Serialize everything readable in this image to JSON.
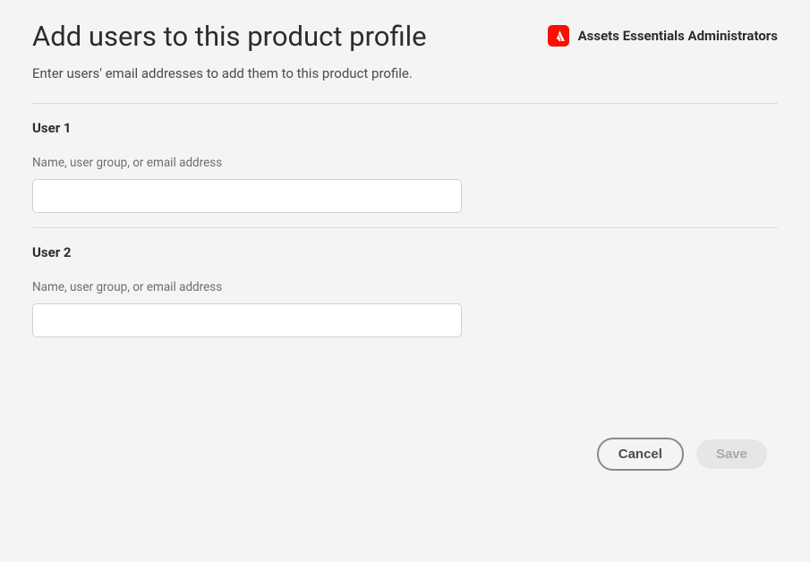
{
  "header": {
    "title": "Add users to this product profile",
    "subtitle": "Enter users' email addresses to add them to this product profile.",
    "product_name": "Assets Essentials Administrators"
  },
  "users": [
    {
      "section_label": "User 1",
      "field_label": "Name, user group, or email address",
      "value": ""
    },
    {
      "section_label": "User 2",
      "field_label": "Name, user group, or email address",
      "value": ""
    }
  ],
  "actions": {
    "cancel_label": "Cancel",
    "save_label": "Save"
  }
}
